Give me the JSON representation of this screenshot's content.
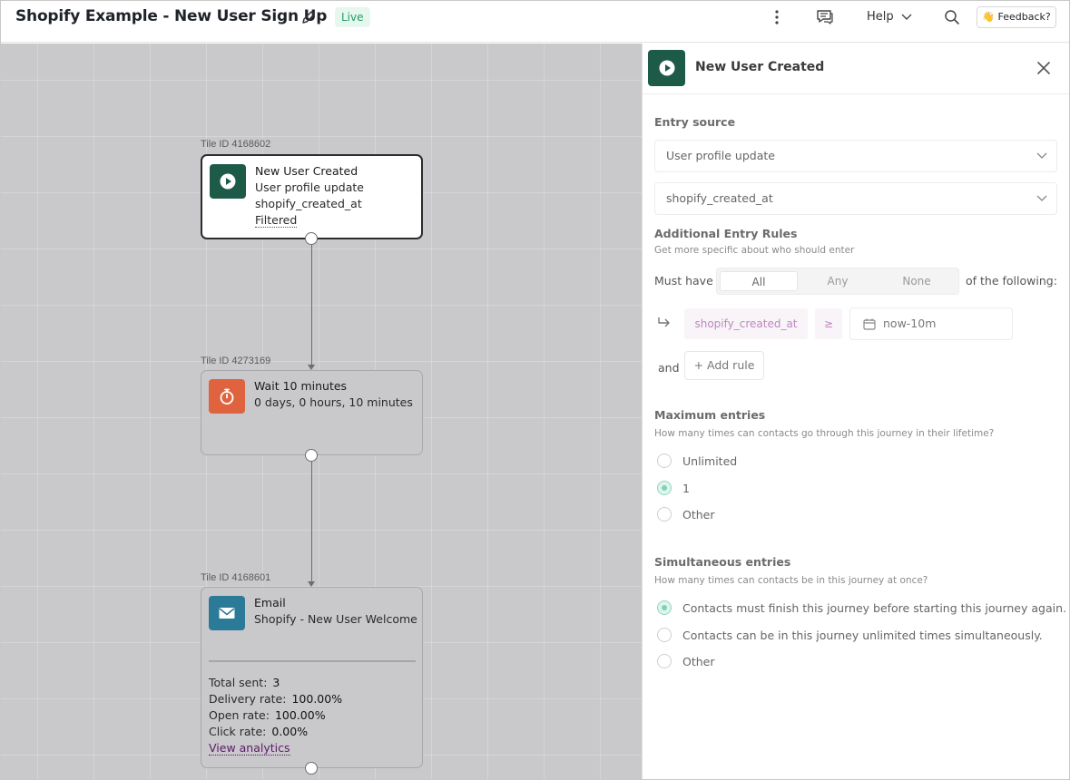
{
  "header": {
    "title": "Shopify Example - New User Sign Up",
    "status_badge": "Live",
    "help_label": "Help",
    "feedback_label": "👋 Feedback?"
  },
  "canvas": {
    "tiles": [
      {
        "tile_id": "Tile ID 4168602",
        "title": "New User Created",
        "line1": "User profile update",
        "line2": "shopify_created_at",
        "line3": "Filtered",
        "icon": "play-icon",
        "color": "#1d5a48"
      },
      {
        "tile_id": "Tile ID 4273169",
        "title": "Wait 10 minutes",
        "line1": "0 days, 0 hours, 10 minutes",
        "icon": "stopwatch-icon",
        "color": "#e0633f"
      },
      {
        "tile_id": "Tile ID 4168601",
        "title": "Email",
        "line1": "Shopify - New User Welcome",
        "icon": "envelope-icon",
        "color": "#2b7a98",
        "stats": {
          "total_sent_label": "Total sent:",
          "total_sent": "3",
          "delivery_label": "Delivery rate:",
          "delivery": "100.00%",
          "open_label": "Open rate:",
          "open": "100.00%",
          "click_label": "Click rate:",
          "click": "0.00%",
          "link": "View analytics"
        }
      }
    ]
  },
  "panel": {
    "title": "New User Created",
    "entry_source_label": "Entry source",
    "entry_source_value": "User profile update",
    "entry_field_value": "shopify_created_at",
    "additional_label": "Additional Entry Rules",
    "additional_help": "Get more specific about who should enter",
    "must_have_label": "Must have",
    "segments": [
      "All",
      "Any",
      "None"
    ],
    "selected_segment": "All",
    "of_following_label": "of the following:",
    "rule": {
      "field": "shopify_created_at",
      "operator": "≥",
      "value": "now-10m"
    },
    "and_label": "and",
    "add_rule_label": "+ Add rule",
    "max_entries": {
      "label": "Maximum entries",
      "help": "How many times can contacts go through this journey in their lifetime?",
      "options": [
        "Unlimited",
        "1",
        "Other"
      ],
      "selected": "1"
    },
    "simultaneous": {
      "label": "Simultaneous entries",
      "help": "How many times can contacts be in this journey at once?",
      "options": [
        "Contacts must finish this journey before starting this journey again.",
        "Contacts can be in this journey unlimited times simultaneously.",
        "Other"
      ],
      "selected": "Contacts must finish this journey before starting this journey again."
    }
  }
}
